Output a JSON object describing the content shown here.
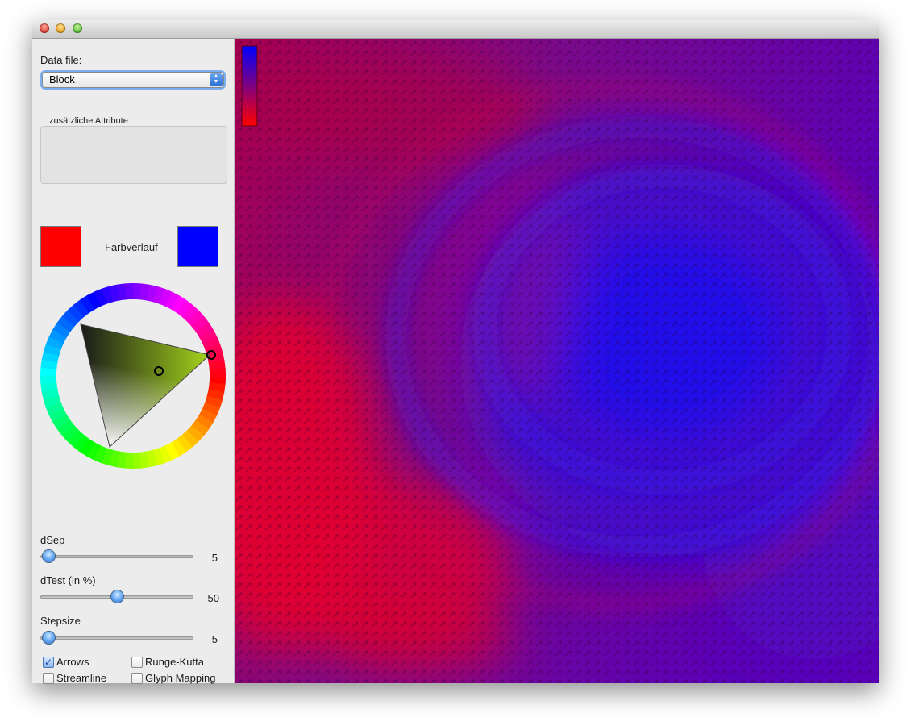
{
  "window": {
    "buttons": [
      "close",
      "minimize",
      "zoom"
    ]
  },
  "sidebar": {
    "data_file_label": "Data file:",
    "data_file_value": "Block",
    "attributes_label": "zusätzliche Attribute",
    "gradient_label": "Farbverlauf",
    "gradient_start_color": "#ff0000",
    "gradient_end_color": "#0000ff",
    "color_wheel_selected_color": "#9acd1a",
    "sliders": [
      {
        "label": "dSep",
        "value": "5",
        "fraction": 0.05
      },
      {
        "label": "dTest (in %)",
        "value": "50",
        "fraction": 0.5
      },
      {
        "label": "Stepsize",
        "value": "5",
        "fraction": 0.05
      }
    ],
    "checkboxes": [
      {
        "label": "Arrows",
        "checked": true
      },
      {
        "label": "Runge-Kutta",
        "checked": false
      },
      {
        "label": "Streamline",
        "checked": false
      },
      {
        "label": "Glyph Mapping",
        "checked": false
      }
    ]
  },
  "visualization": {
    "legend_top_color": "#0000ff",
    "legend_bottom_color": "#ff0000",
    "arrows_visible": true
  }
}
